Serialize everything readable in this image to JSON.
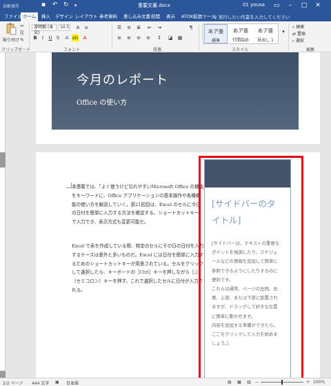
{
  "titlebar": {
    "autosave": "自動保存",
    "doc_title": "重要文書.docx",
    "user": "01 yousa"
  },
  "tabs": [
    "ファイル",
    "ホーム",
    "挿入",
    "デザイン",
    "レイアウト",
    "参考資料",
    "差し込み文書",
    "校閲",
    "表示",
    "ATOK拡張ツール"
  ],
  "active_tab": "ホーム",
  "tellme": "実行したい作業を入力してください",
  "ribbon": {
    "paste": "貼り付け",
    "font_name": "游明朝 (本文)",
    "font_size": "10.5",
    "groups": {
      "clipboard": "クリップボード",
      "font": "フォント",
      "paragraph": "段落",
      "styles": "スタイル",
      "editing": "編集"
    },
    "styles": [
      {
        "sample": "あア亜",
        "name": "標準"
      },
      {
        "sample": "あア亜",
        "name": "行間詰め"
      },
      {
        "sample": "あア亜",
        "name": "見出し 1"
      }
    ],
    "editing": [
      "検索",
      "置換",
      "選択"
    ]
  },
  "page1": {
    "title": "今月のレポート",
    "subtitle": "Office の使い方"
  },
  "body": {
    "para1": [
      "本連載では、「よく使うけど忘れやすいMicrosoft Office の機能」",
      "をキーワードに、Office アプリケーションの基本操作や各種機",
      "能の使い方を解説していく。第21回目は、Excel のセルに今日",
      "の日付を簡単に入力する方法を確認する。ショートカットキー",
      "で入力でき、表示方式も変更可能だ。"
    ],
    "para2": [
      "Excel で表を作成している際、特定のセルにその日の日付を入力",
      "するケースは意外と多いものだ。Excel には日付を簡単に入力す",
      "るためのショートカットキーが用意されている。セルをクリック",
      "して選択したら、キーボードの［Ctrl］キーを押しながら［;］",
      "（セミコロン）キーを押す。これで選択したセルに日付が入力さ",
      "れる。"
    ]
  },
  "sidebar": {
    "title": [
      "[サイドバーのタ",
      "イトル]"
    ],
    "body": [
      "[サイドバーは、テキストの重要な",
      "ポイントを強調したり、スケジュ",
      "ールなどの情報を追加して簡単に",
      "参照できるようにしたりするのに",
      "便利です。",
      "これらは通常、ページの左側、右",
      "側、上部、または下部に配置され",
      "ますが、ドラッグして好きな位置",
      "に簡単に動かせます。",
      "内容を追加する準備ができたら、",
      "ここをクリックして入力を始めま",
      "しょう。]"
    ]
  },
  "statusbar": {
    "page": "2/2 ページ",
    "words": "444 文字",
    "language": "日本語",
    "zoom": "100%"
  }
}
